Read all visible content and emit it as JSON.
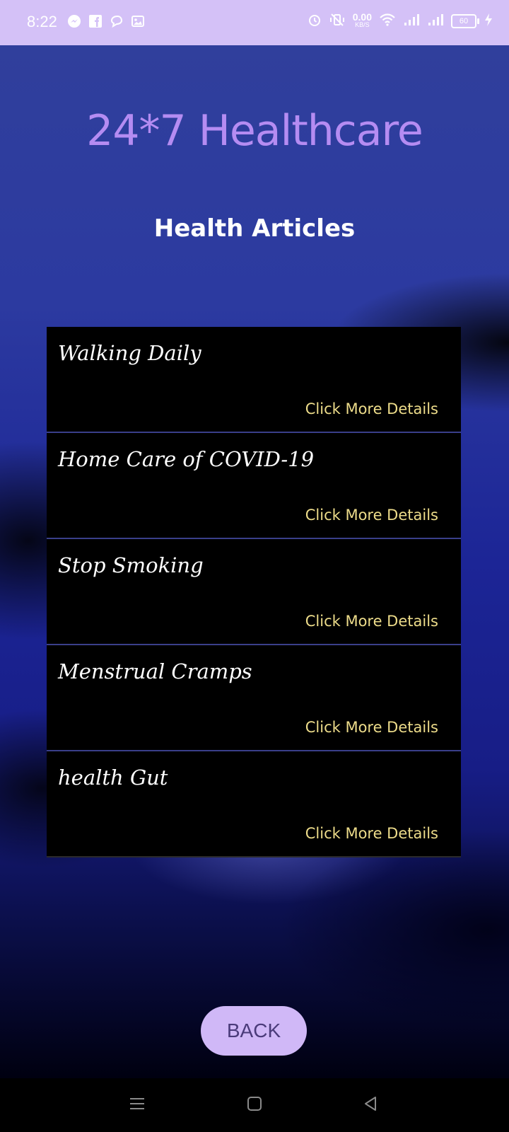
{
  "status_bar": {
    "time": "8:22",
    "left_icons": [
      "messenger-icon",
      "facebook-icon",
      "chat-bubble-icon",
      "gallery-icon"
    ],
    "net_speed_value": "0.00",
    "net_speed_unit": "KB/S",
    "battery_level": "60",
    "right_icons": [
      "alarm-icon",
      "vibrate-off-icon",
      "wifi-icon",
      "signal-icon",
      "signal-icon",
      "battery-icon",
      "charging-icon"
    ]
  },
  "header": {
    "app_title": "24*7 Healthcare",
    "section_title": "Health Articles"
  },
  "articles": [
    {
      "title": "Walking Daily",
      "link_label": "Click More Details"
    },
    {
      "title": "Home Care of COVID-19",
      "link_label": "Click More Details"
    },
    {
      "title": "Stop Smoking",
      "link_label": "Click More Details"
    },
    {
      "title": "Menstrual Cramps",
      "link_label": "Click More Details"
    },
    {
      "title": "health Gut",
      "link_label": "Click More Details"
    }
  ],
  "back_button": {
    "label": "BACK"
  },
  "nav_bar": {
    "icons": [
      "menu-icon",
      "home-icon",
      "back-icon"
    ]
  },
  "colors": {
    "status_bar_bg": "#d4c1f7",
    "app_title": "#b58cf2",
    "link": "#eddc8a",
    "button_bg": "#d0b8f7",
    "button_text": "#4a3b7a"
  }
}
